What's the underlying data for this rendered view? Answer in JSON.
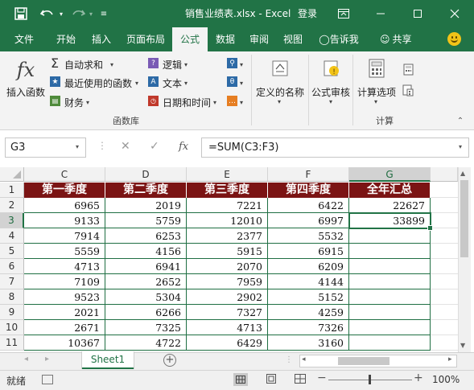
{
  "window": {
    "title": "销售业绩表.xlsx - Excel",
    "login_label": "登录"
  },
  "tabs": [
    {
      "label": "文件"
    },
    {
      "label": "开始"
    },
    {
      "label": "插入"
    },
    {
      "label": "页面布局"
    },
    {
      "label": "公式",
      "active": true
    },
    {
      "label": "数据"
    },
    {
      "label": "审阅"
    },
    {
      "label": "视图"
    }
  ],
  "tell_me": "告诉我",
  "share_label": "共享",
  "ribbon": {
    "insert_function": "插入函数",
    "autosum": "自动求和",
    "recent": "最近使用的函数",
    "financial": "财务",
    "logical": "逻辑",
    "text": "文本",
    "datetime": "日期和时间",
    "defined_names": "定义的名称",
    "formula_auditing": "公式审核",
    "calc_options": "计算选项",
    "group_library": "函数库",
    "group_calc": "计算",
    "fx_symbol": "fx"
  },
  "formula_bar": {
    "name_box": "G3",
    "fx_label": "fx",
    "formula": "=SUM(C3:F3)"
  },
  "grid": {
    "columns": [
      "C",
      "D",
      "E",
      "F",
      "G"
    ],
    "rows": [
      "1",
      "2",
      "3",
      "4",
      "5",
      "6",
      "7",
      "8",
      "9",
      "10",
      "11"
    ],
    "header_row": [
      "第一季度",
      "第二季度",
      "第三季度",
      "第四季度",
      "全年汇总"
    ],
    "data": [
      [
        "6965",
        "2019",
        "7221",
        "6422",
        "22627"
      ],
      [
        "9133",
        "5759",
        "12010",
        "6997",
        "33899"
      ],
      [
        "7914",
        "6253",
        "2377",
        "5532",
        ""
      ],
      [
        "5559",
        "4156",
        "5915",
        "6915",
        ""
      ],
      [
        "4713",
        "6941",
        "2070",
        "6209",
        ""
      ],
      [
        "7109",
        "2652",
        "7959",
        "4144",
        ""
      ],
      [
        "9523",
        "5304",
        "2902",
        "5152",
        ""
      ],
      [
        "2021",
        "6266",
        "7327",
        "4259",
        ""
      ],
      [
        "2671",
        "7325",
        "4713",
        "7326",
        ""
      ],
      [
        "10367",
        "4722",
        "6429",
        "3160",
        ""
      ]
    ],
    "header_color": "#7b1414",
    "accent_color": "#217346"
  },
  "sheet_tab": "Sheet1",
  "status": {
    "ready": "就绪",
    "zoom": "100%"
  }
}
